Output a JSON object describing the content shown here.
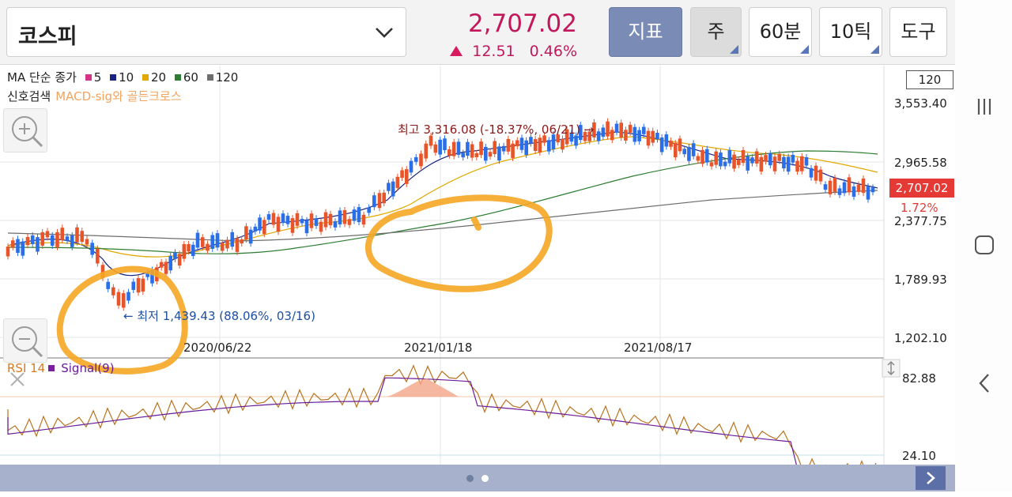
{
  "header": {
    "market_name": "코스피",
    "price": "2,707.02",
    "change": "12.51",
    "change_pct": "0.46%",
    "buttons": {
      "indicator": "지표",
      "period": "주",
      "interval": "60분",
      "tick": "10틱",
      "tools": "도구"
    }
  },
  "legend": {
    "ma_prefix": "MA 단순 종가",
    "ma_periods": [
      {
        "label": "5",
        "color": "#d63384"
      },
      {
        "label": "10",
        "color": "#1a237e"
      },
      {
        "label": "20",
        "color": "#e0a800"
      },
      {
        "label": "60",
        "color": "#2e7d32"
      },
      {
        "label": "120",
        "color": "#6d6d6d"
      }
    ],
    "signal_prefix": "신호검색",
    "signal_text": "MACD-sig와 골든크로스",
    "period_box": "120"
  },
  "price_axis": {
    "labels": [
      "3,553.40",
      "2,965.58",
      "2,377.75",
      "1,789.93",
      "1,202.10"
    ],
    "current_tag": "2,707.02",
    "current_pct": "1.72%"
  },
  "date_axis": {
    "labels": [
      "2020/06/22",
      "2021/01/18",
      "2021/08/17"
    ]
  },
  "annotations": {
    "high": "최고 3,316.08 (-18.37%, 06/21) →",
    "low": "← 최저 1,439.43 (88.06%, 03/16)"
  },
  "rsi": {
    "label": "RSI 14",
    "signal_label": "Signal(9)",
    "top": "82.88",
    "bottom": "24.10"
  },
  "colors": {
    "up": "#e8552a",
    "down": "#2a6ee8",
    "accent": "#c2185b",
    "highlighter": "#f5a623"
  }
}
